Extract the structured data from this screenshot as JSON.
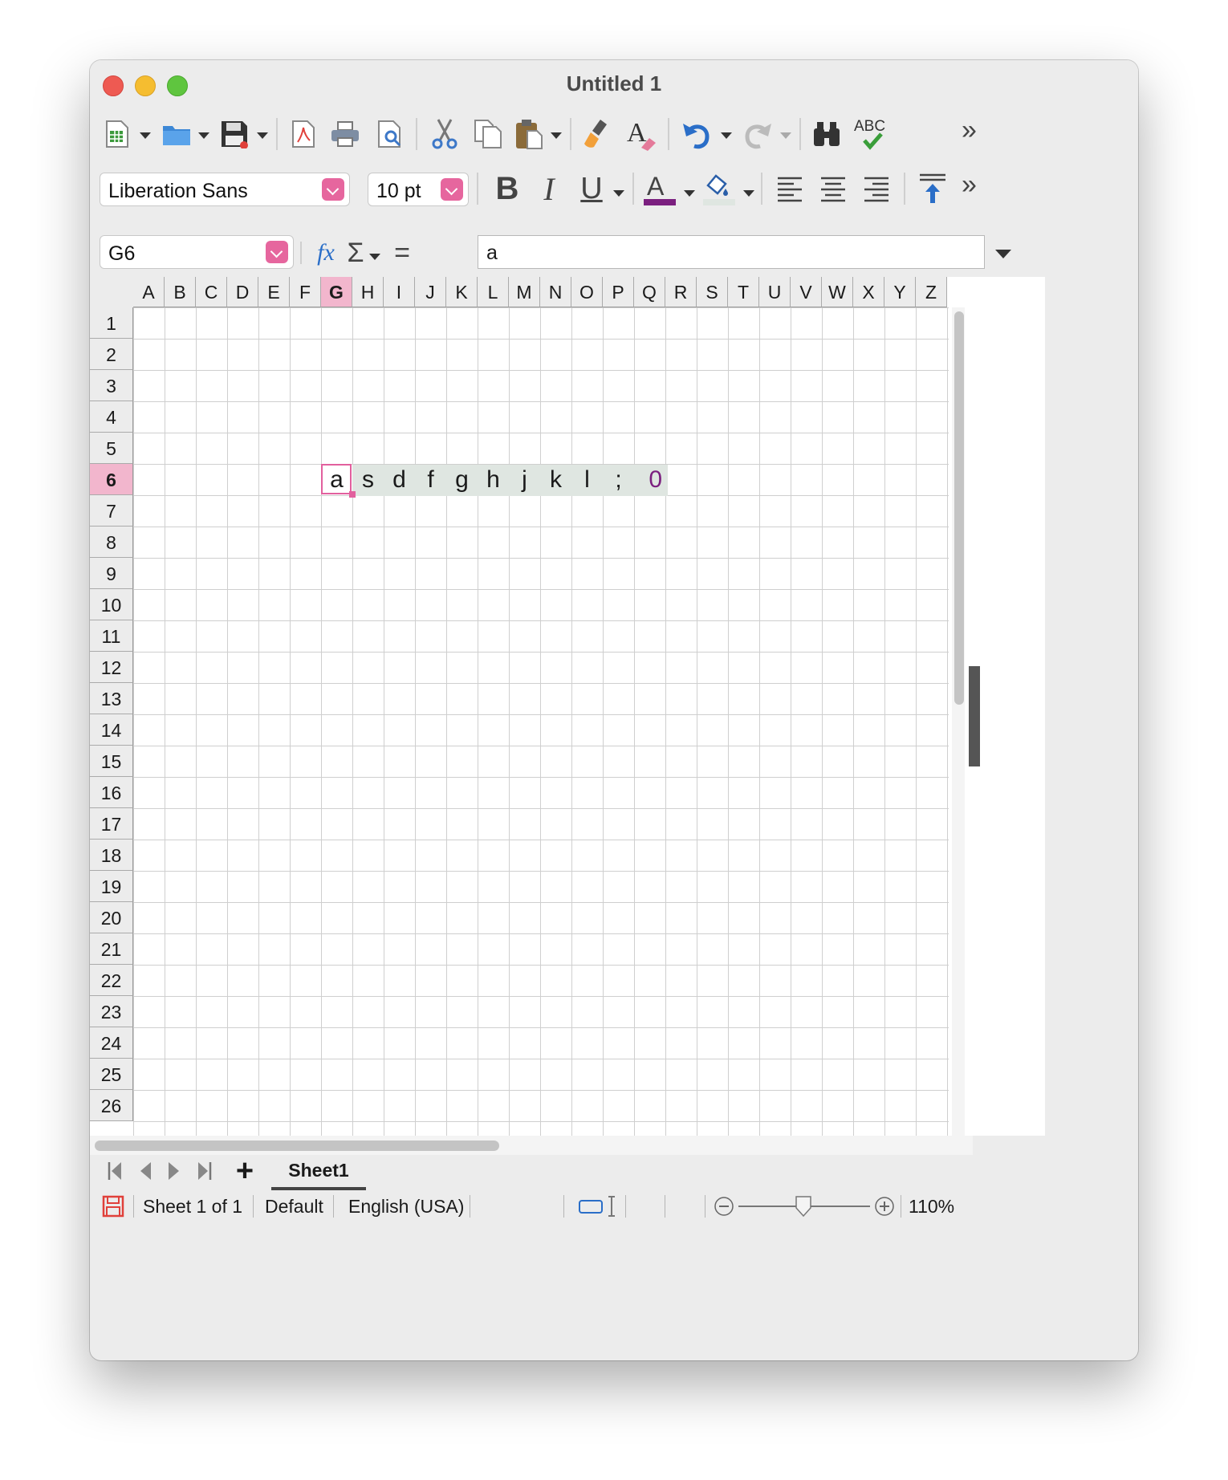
{
  "window": {
    "title": "Untitled 1"
  },
  "format": {
    "font_name": "Liberation Sans",
    "font_size": "10 pt"
  },
  "formula_bar": {
    "name_box": "G6",
    "content": "a"
  },
  "sheet": {
    "columns": [
      "A",
      "B",
      "C",
      "D",
      "E",
      "F",
      "G",
      "H",
      "I",
      "J",
      "K",
      "L",
      "M",
      "N",
      "O",
      "P",
      "Q",
      "R",
      "S",
      "T",
      "U",
      "V",
      "W",
      "X",
      "Y",
      "Z"
    ],
    "selected_column": "G",
    "rows": [
      "1",
      "2",
      "3",
      "4",
      "5",
      "6",
      "7",
      "8",
      "9",
      "10",
      "11",
      "12",
      "13",
      "14",
      "15",
      "16",
      "17",
      "18",
      "19",
      "20",
      "21",
      "22",
      "23",
      "24",
      "25",
      "26"
    ],
    "selected_row": "6",
    "row6_cells": [
      {
        "col": "G",
        "text": "a"
      },
      {
        "col": "H",
        "text": "s"
      },
      {
        "col": "I",
        "text": "d"
      },
      {
        "col": "J",
        "text": "f"
      },
      {
        "col": "K",
        "text": "g"
      },
      {
        "col": "L",
        "text": "h"
      },
      {
        "col": "M",
        "text": "j"
      },
      {
        "col": "N",
        "text": "k"
      },
      {
        "col": "O",
        "text": "l"
      },
      {
        "col": "P",
        "text": ";"
      },
      {
        "col": "Q",
        "text": "0"
      }
    ],
    "number_color": "#7b1f7f"
  },
  "tabs": {
    "sheet_name": "Sheet1"
  },
  "status": {
    "sheet_info": "Sheet 1 of 1",
    "page_style": "Default",
    "language": "English (USA)",
    "zoom": "110%"
  },
  "toolbar_icons": [
    "new-spreadsheet-icon",
    "open-folder-icon",
    "save-icon",
    "export-pdf-icon",
    "print-icon",
    "print-preview-icon",
    "cut-icon",
    "copy-icon",
    "paste-icon",
    "clone-formatting-icon",
    "clear-formatting-icon",
    "undo-icon",
    "redo-icon",
    "find-replace-icon",
    "spellcheck-icon"
  ],
  "colors": {
    "accent": "#e6669e",
    "selection_fill": "#dfe6e1",
    "font_color": "#7b1f7f"
  }
}
